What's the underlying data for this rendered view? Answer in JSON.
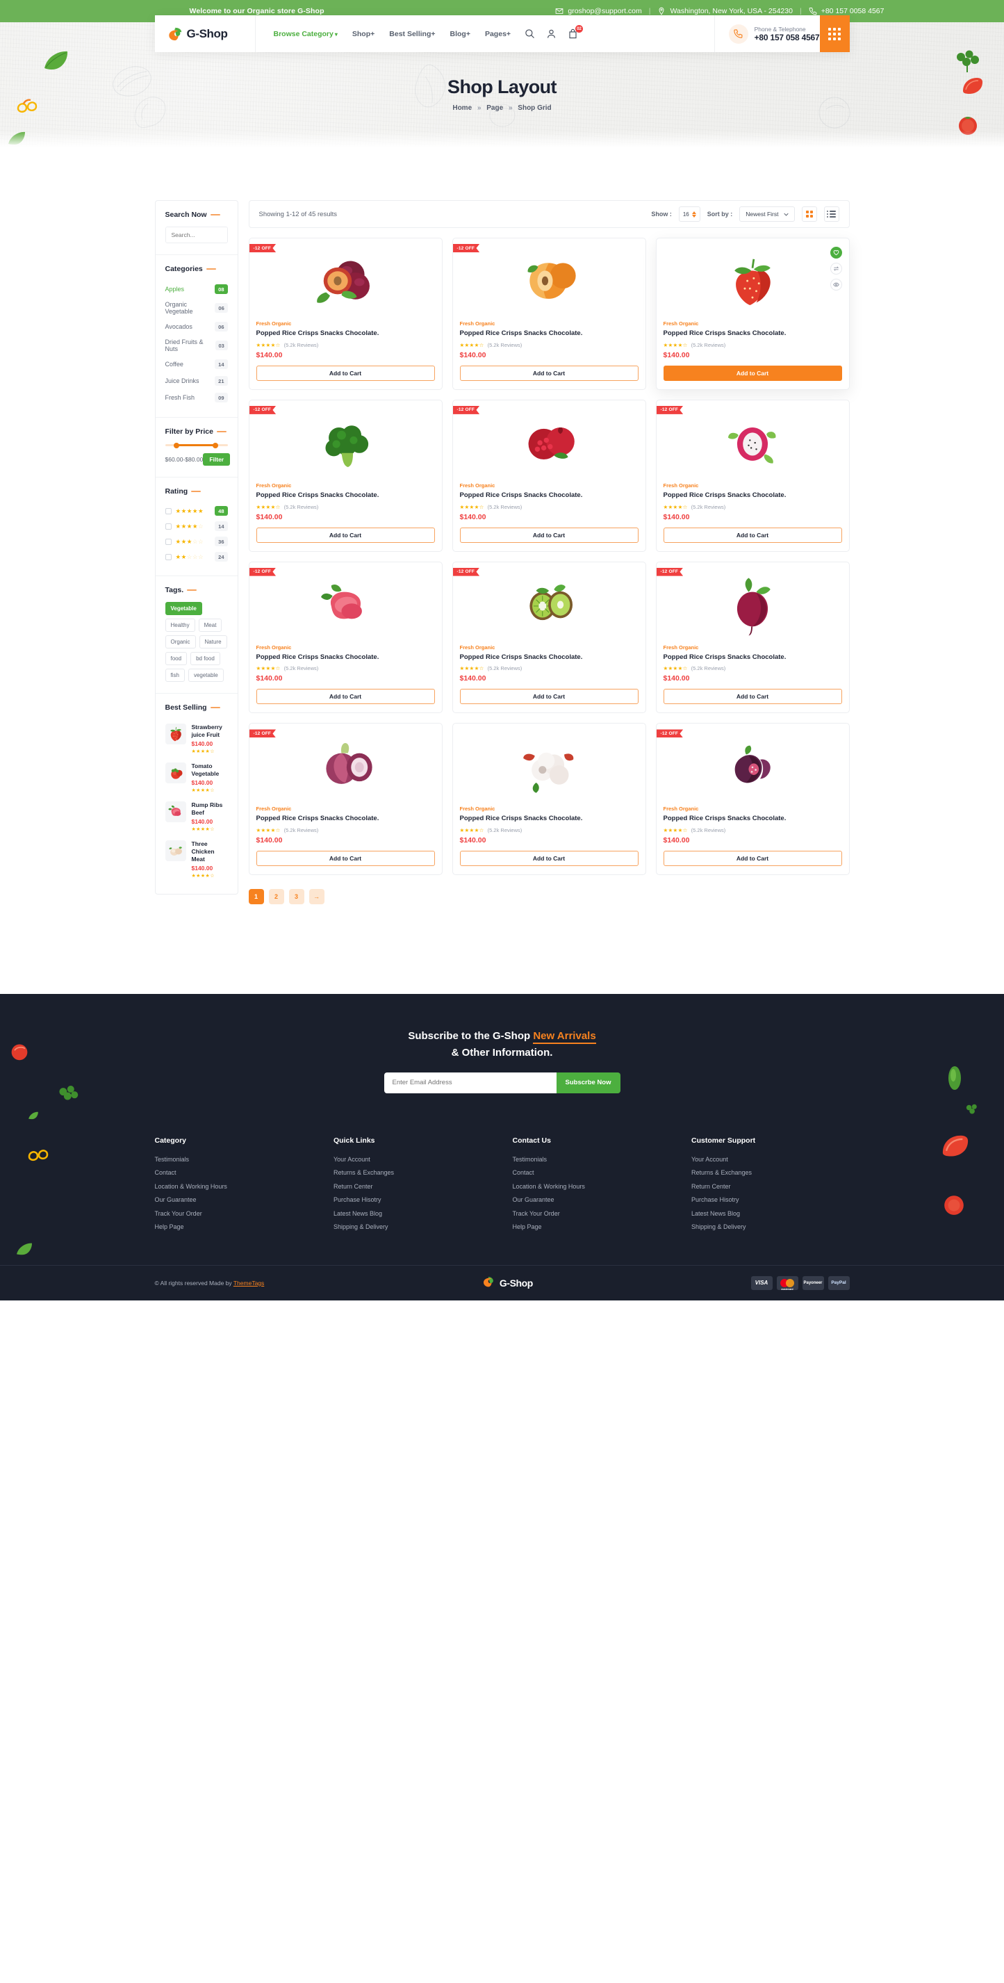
{
  "topbar": {
    "welcome": "Welcome to our Organic store G-Shop",
    "email": "groshop@support.com",
    "address": "Washington, New York, USA - 254230",
    "phone": "+80 157 0058 4567"
  },
  "header": {
    "brand": "G-Shop",
    "nav": [
      {
        "label": "Browse Category",
        "caret": true,
        "active": true
      },
      {
        "label": "Shop+",
        "caret": false,
        "active": false
      },
      {
        "label": "Best Selling+",
        "caret": false,
        "active": false
      },
      {
        "label": "Blog+",
        "caret": false,
        "active": false
      },
      {
        "label": "Pages+",
        "caret": false,
        "active": false
      }
    ],
    "cart_count": "02",
    "phone_label": "Phone & Telephone",
    "phone_number": "+80 157 058 4567"
  },
  "hero": {
    "title": "Shop Layout",
    "crumb_home": "Home",
    "crumb_page": "Page",
    "crumb_current": "Shop Grid",
    "separator": "»"
  },
  "sidebar": {
    "search": {
      "title": "Search Now",
      "placeholder": "Search..."
    },
    "categories": {
      "title": "Categories",
      "items": [
        {
          "name": "Apples",
          "count": "08",
          "active": true
        },
        {
          "name": "Organic Vegetable",
          "count": "06",
          "active": false
        },
        {
          "name": "Avocados",
          "count": "06",
          "active": false
        },
        {
          "name": "Dried Fruits & Nuts",
          "count": "03",
          "active": false
        },
        {
          "name": "Coffee",
          "count": "14",
          "active": false
        },
        {
          "name": "Juice Drinks",
          "count": "21",
          "active": false
        },
        {
          "name": "Fresh Fish",
          "count": "09",
          "active": false
        }
      ]
    },
    "price": {
      "title": "Filter by Price",
      "range_text": "$60.00-$80.00",
      "button": "Filter"
    },
    "rating": {
      "title": "Rating",
      "items": [
        {
          "filled": 5,
          "count": "48",
          "top": true
        },
        {
          "filled": 4,
          "count": "14",
          "top": false
        },
        {
          "filled": 3,
          "count": "36",
          "top": false
        },
        {
          "filled": 2,
          "count": "24",
          "top": false
        }
      ]
    },
    "tags": {
      "title": "Tags.",
      "items": [
        {
          "label": "Vegetable",
          "active": true
        },
        {
          "label": "Healthy",
          "active": false
        },
        {
          "label": "Meat",
          "active": false
        },
        {
          "label": "Organic",
          "active": false
        },
        {
          "label": "Nature",
          "active": false
        },
        {
          "label": "food",
          "active": false
        },
        {
          "label": "bd food",
          "active": false
        },
        {
          "label": "fish",
          "active": false
        },
        {
          "label": "vegetable",
          "active": false
        }
      ]
    },
    "best_selling": {
      "title": "Best Selling",
      "items": [
        {
          "name": "Strawberry juice Fruit",
          "price": "$140.00",
          "stars": 4,
          "img": "strawberry"
        },
        {
          "name": "Tomato Vegetable",
          "price": "$140.00",
          "stars": 4,
          "img": "tomato"
        },
        {
          "name": "Rump Ribs Beef",
          "price": "$140.00",
          "stars": 4,
          "img": "beef"
        },
        {
          "name": "Three  Chicken Meat",
          "price": "$140.00",
          "stars": 4,
          "img": "chicken"
        }
      ]
    }
  },
  "toolbar": {
    "showing": "Showing 1-12 of 45 results",
    "show_label": "Show :",
    "show_value": "16",
    "sort_label": "Sort by :",
    "sort_value": "Newest First",
    "grid_view_icon": "grid-view-icon",
    "list_view_icon": "list-view-icon"
  },
  "products": [
    {
      "badge": "-12 OFF",
      "category": "Fresh Organic",
      "name": "Popped Rice Crisps Snacks Chocolate.",
      "stars": 4,
      "reviews": "(5.2k Reviews)",
      "price": "$140.00",
      "button": "Add to Cart",
      "img": "plum",
      "hovered": false,
      "solid": false
    },
    {
      "badge": "-12 OFF",
      "category": "Fresh Organic",
      "name": "Popped Rice Crisps Snacks Chocolate.",
      "stars": 4,
      "reviews": "(5.2k Reviews)",
      "price": "$140.00",
      "button": "Add to Cart",
      "img": "apricot",
      "hovered": false,
      "solid": false
    },
    {
      "badge": "",
      "category": "Fresh Organic",
      "name": "Popped Rice Crisps Snacks Chocolate.",
      "stars": 4,
      "reviews": "(5.2k Reviews)",
      "price": "$140.00",
      "button": "Add to Cart",
      "img": "strawberry",
      "hovered": true,
      "solid": true
    },
    {
      "badge": "-12 OFF",
      "category": "Fresh Organic",
      "name": "Popped Rice Crisps Snacks Chocolate.",
      "stars": 4,
      "reviews": "(5.2k Reviews)",
      "price": "$140.00",
      "button": "Add to Cart",
      "img": "broccoli",
      "hovered": false,
      "solid": false
    },
    {
      "badge": "-12 OFF",
      "category": "Fresh Organic",
      "name": "Popped Rice Crisps Snacks Chocolate.",
      "stars": 4,
      "reviews": "(5.2k Reviews)",
      "price": "$140.00",
      "button": "Add to Cart",
      "img": "pomegranate",
      "hovered": false,
      "solid": false
    },
    {
      "badge": "-12 OFF",
      "category": "Fresh Organic",
      "name": "Popped Rice Crisps Snacks Chocolate.",
      "stars": 4,
      "reviews": "(5.2k Reviews)",
      "price": "$140.00",
      "button": "Add to Cart",
      "img": "dragonfruit",
      "hovered": false,
      "solid": false
    },
    {
      "badge": "-12 OFF",
      "category": "Fresh Organic",
      "name": "Popped Rice Crisps Snacks Chocolate.",
      "stars": 4,
      "reviews": "(5.2k Reviews)",
      "price": "$140.00",
      "button": "Add to Cart",
      "img": "beef",
      "hovered": false,
      "solid": false
    },
    {
      "badge": "-12 OFF",
      "category": "Fresh Organic",
      "name": "Popped Rice Crisps Snacks Chocolate.",
      "stars": 4,
      "reviews": "(5.2k Reviews)",
      "price": "$140.00",
      "button": "Add to Cart",
      "img": "kiwi",
      "hovered": false,
      "solid": false
    },
    {
      "badge": "-12 OFF",
      "category": "Fresh Organic",
      "name": "Popped Rice Crisps Snacks Chocolate.",
      "stars": 4,
      "reviews": "(5.2k Reviews)",
      "price": "$140.00",
      "button": "Add to Cart",
      "img": "beet",
      "hovered": false,
      "solid": false
    },
    {
      "badge": "-12 OFF",
      "category": "Fresh Organic",
      "name": "Popped Rice Crisps Snacks Chocolate.",
      "stars": 4,
      "reviews": "(5.2k Reviews)",
      "price": "$140.00",
      "button": "Add to Cart",
      "img": "onion",
      "hovered": false,
      "solid": false
    },
    {
      "badge": "",
      "category": "Fresh Organic",
      "name": "Popped Rice Crisps Snacks Chocolate.",
      "stars": 4,
      "reviews": "(5.2k Reviews)",
      "price": "$140.00",
      "button": "Add to Cart",
      "img": "lychee",
      "hovered": false,
      "solid": false
    },
    {
      "badge": "-12 OFF",
      "category": "Fresh Organic",
      "name": "Popped Rice Crisps Snacks Chocolate.",
      "stars": 4,
      "reviews": "(5.2k Reviews)",
      "price": "$140.00",
      "button": "Add to Cart",
      "img": "fig",
      "hovered": false,
      "solid": false
    }
  ],
  "pagination": [
    {
      "label": "1",
      "active": true
    },
    {
      "label": "2",
      "active": false
    },
    {
      "label": "3",
      "active": false
    },
    {
      "label": "→",
      "active": false
    }
  ],
  "newsletter": {
    "line1_a": "Subscribe to the G-Shop ",
    "line1_accent": "New Arrivals",
    "line2": "& Other Information.",
    "placeholder": "Enter Email Address",
    "button": "Subscrbe Now"
  },
  "footer": {
    "columns": [
      {
        "title": "Category",
        "links": [
          "Testimonials",
          "Contact",
          "Location & Working Hours",
          "Our Guarantee",
          "Track Your Order",
          "Help Page"
        ]
      },
      {
        "title": "Quick Links",
        "links": [
          "Your Account",
          "Returns & Exchanges",
          "Return Center",
          "Purchase Hisotry",
          "Latest News Blog",
          "Shipping & Delivery"
        ]
      },
      {
        "title": "Contact Us",
        "links": [
          "Testimonials",
          "Contact",
          "Location & Working Hours",
          "Our Guarantee",
          "Track Your Order",
          "Help Page"
        ]
      },
      {
        "title": "Customer Support",
        "links": [
          "Your Account",
          "Returns & Exchanges",
          "Return Center",
          "Purchase Hisotry",
          "Latest News Blog",
          "Shipping & Delivery"
        ]
      }
    ],
    "copyright_pre": "© All rights reserved Made by ",
    "copyright_link": "ThemeTags",
    "brand": "G-Shop",
    "payments": [
      "VISA",
      "mastercard",
      "Payoneer",
      "PayPal"
    ]
  },
  "colors": {
    "green": "#4caf3f",
    "top_green": "#6cb257",
    "orange": "#f7821f",
    "red": "#ef3f3f",
    "dark": "#1a1f2c"
  }
}
